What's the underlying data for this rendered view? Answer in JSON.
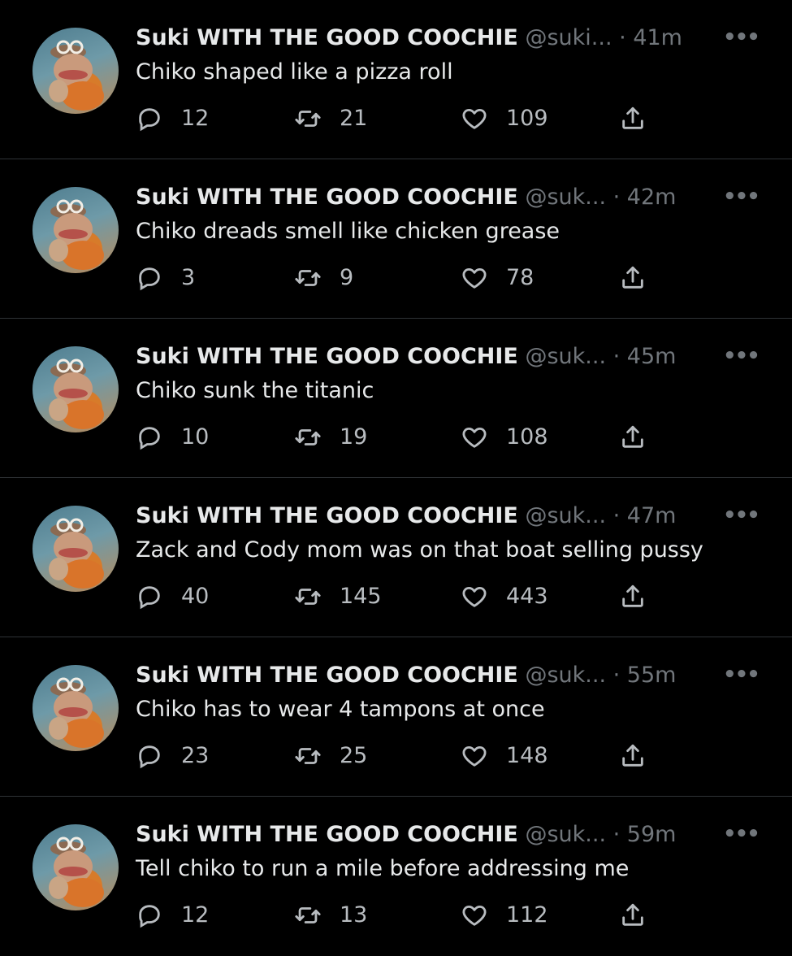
{
  "colors": {
    "background": "#000000",
    "text": "#e7e9ea",
    "muted": "#71767b",
    "divider": "#2f3336"
  },
  "icons": {
    "reply": "reply-icon",
    "retweet": "retweet-icon",
    "like": "heart-icon",
    "share": "share-icon",
    "more": "more-icon"
  },
  "tweets": [
    {
      "name": "Suki WITH THE GOOD COOCHIE",
      "handle": "@suki...",
      "time": "41m",
      "text": "Chiko shaped like a pizza roll",
      "replies": "12",
      "retweets": "21",
      "likes": "109"
    },
    {
      "name": "Suki WITH THE GOOD COOCHIE",
      "handle": "@suk...",
      "time": "42m",
      "text": "Chiko dreads smell like chicken grease",
      "replies": "3",
      "retweets": "9",
      "likes": "78"
    },
    {
      "name": "Suki WITH THE GOOD COOCHIE",
      "handle": "@suk...",
      "time": "45m",
      "text": "Chiko sunk the titanic",
      "replies": "10",
      "retweets": "19",
      "likes": "108"
    },
    {
      "name": "Suki WITH THE GOOD COOCHIE",
      "handle": "@suk...",
      "time": "47m",
      "text": "Zack and Cody mom was on that boat selling pussy",
      "replies": "40",
      "retweets": "145",
      "likes": "443"
    },
    {
      "name": "Suki WITH THE GOOD COOCHIE",
      "handle": "@suk...",
      "time": "55m",
      "text": "Chiko has to wear 4 tampons at once",
      "replies": "23",
      "retweets": "25",
      "likes": "148"
    },
    {
      "name": "Suki WITH THE GOOD COOCHIE",
      "handle": "@suk...",
      "time": "59m",
      "text": "Tell chiko to run a mile before addressing me",
      "replies": "12",
      "retweets": "13",
      "likes": "112"
    }
  ]
}
